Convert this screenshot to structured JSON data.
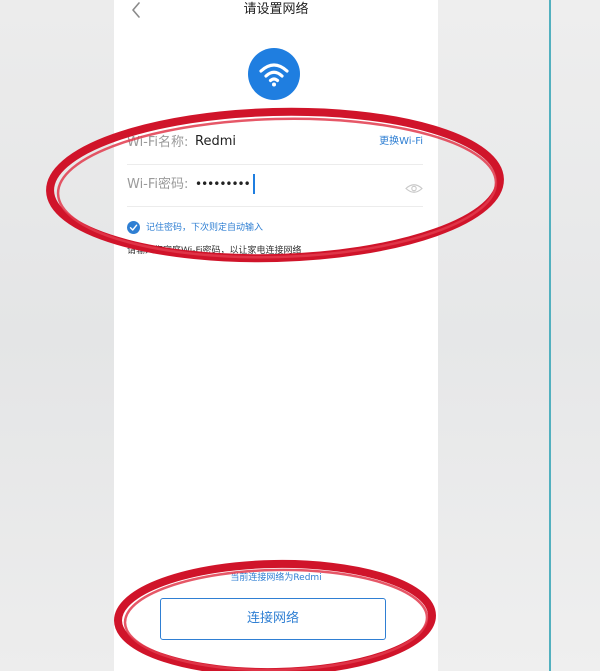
{
  "header": {
    "back_icon": "chevron-left-icon",
    "title": "请设置网络"
  },
  "wifi_icon": "wifi-icon",
  "form": {
    "name_label": "Wi-Fi名称:",
    "name_value": "Redmi",
    "change_wifi": "更换Wi-Fi",
    "password_label": "Wi-Fi密码:",
    "password_masked": "•••••••••",
    "eye_icon": "eye-icon"
  },
  "remember": {
    "checked": true,
    "label": "记住密码，下次则定自动输入"
  },
  "hint": "请输入您家庭Wi-Fi密码，以让家电连接网络",
  "current_network": "当前连接网络为Redmi",
  "connect_button": "连接网络",
  "colors": {
    "accent": "#2f7fd3",
    "wifi_circle": "#1f7ee0",
    "annotation_red": "#d0142a",
    "right_rule": "#52b0bf"
  }
}
